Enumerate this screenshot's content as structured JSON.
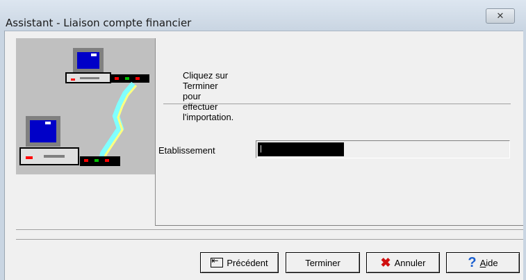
{
  "window": {
    "title": "Assistant - Liaison compte financier",
    "close_glyph": "✕"
  },
  "main": {
    "instruction": "Cliquez sur Terminer pour effectuer l'importation.",
    "etablissement_label": "Etablissement",
    "etablissement_value": "|"
  },
  "buttons": {
    "prev_label": "Précédent",
    "finish_label": "Terminer",
    "cancel_label": "Annuler",
    "help_label_first": "A",
    "help_label_rest": "ide"
  },
  "icons": {
    "close": "close-icon",
    "prev": "previous-step-icon",
    "cancel": "cancel-x-icon",
    "help": "help-question-icon",
    "illustration": "connected-computers-icon"
  },
  "colors": {
    "title_bg": "#c9d5e2",
    "window_bg": "#f0f0f0",
    "illustration_bg": "#c0c0c0",
    "cancel_icon": "#d01010",
    "help_icon": "#1a5fd0"
  }
}
